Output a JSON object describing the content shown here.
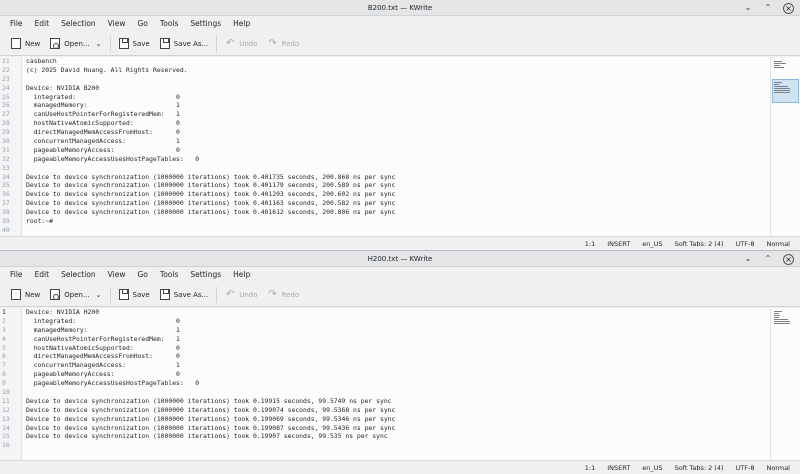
{
  "windows": [
    {
      "title": "B200.txt — KWrite",
      "menu": [
        "File",
        "Edit",
        "Selection",
        "View",
        "Go",
        "Tools",
        "Settings",
        "Help"
      ],
      "toolbar": {
        "new": "New",
        "open": "Open...",
        "save": "Save",
        "save_as": "Save As...",
        "undo": "Undo",
        "redo": "Redo"
      },
      "line_numbers": [
        "21",
        "22",
        "23",
        "24",
        "25",
        "26",
        "27",
        "28",
        "29",
        "30",
        "31",
        "32",
        "33",
        "34",
        "35",
        "36",
        "37",
        "38",
        "39",
        "40"
      ],
      "lines": [
        "casbench",
        "(c) 2025 David Huang. All Rights Reserved.",
        "",
        "Device: NVIDIA B200",
        "  integrated:                          0",
        "  managedMemory:                       1",
        "  canUseHostPointerForRegisteredMem:   1",
        "  hostNativeAtomicSupported:           0",
        "  directManagedMemAccessFromHost:      0",
        "  concurrentManagedAccess:             1",
        "  pageableMemoryAccess:                0",
        "  pageableMemoryAccessUsesHostPageTables:   0",
        "",
        "Device to device synchronization (1000000 iterations) took 0.401735 seconds, 200.868 ns per sync",
        "Device to device synchronization (1000000 iterations) took 0.401179 seconds, 200.589 ns per sync",
        "Device to device synchronization (1000000 iterations) took 0.401203 seconds, 200.602 ns per sync",
        "Device to device synchronization (1000000 iterations) took 0.401163 seconds, 200.582 ns per sync",
        "Device to device synchronization (1000000 iterations) took 0.401612 seconds, 200.806 ns per sync",
        "root:~#",
        ""
      ],
      "status": {
        "position": "1:1",
        "mode": "INSERT",
        "lang": "en_US",
        "tabs": "Soft Tabs: 2 (4)",
        "encoding": "UTF-8",
        "eol": "Normal"
      }
    },
    {
      "title": "H200.txt — KWrite",
      "menu": [
        "File",
        "Edit",
        "Selection",
        "View",
        "Go",
        "Tools",
        "Settings",
        "Help"
      ],
      "toolbar": {
        "new": "New",
        "open": "Open...",
        "save": "Save",
        "save_as": "Save As...",
        "undo": "Undo",
        "redo": "Redo"
      },
      "line_numbers": [
        "1",
        "2",
        "3",
        "4",
        "5",
        "6",
        "7",
        "8",
        "9",
        "10",
        "11",
        "12",
        "13",
        "14",
        "15",
        "16"
      ],
      "lines": [
        "Device: NVIDIA H200",
        "  integrated:                          0",
        "  managedMemory:                       1",
        "  canUseHostPointerForRegisteredMem:   1",
        "  hostNativeAtomicSupported:           0",
        "  directManagedMemAccessFromHost:      0",
        "  concurrentManagedAccess:             1",
        "  pageableMemoryAccess:                0",
        "  pageableMemoryAccessUsesHostPageTables:   0",
        "",
        "Device to device synchronization (1000000 iterations) took 0.19915 seconds, 99.5749 ns per sync",
        "Device to device synchronization (1000000 iterations) took 0.199074 seconds, 99.5368 ns per sync",
        "Device to device synchronization (1000000 iterations) took 0.199069 seconds, 99.5346 ns per sync",
        "Device to device synchronization (1000000 iterations) took 0.199087 seconds, 99.5436 ns per sync",
        "Device to device synchronization (1000000 iterations) took 0.19907 seconds, 99.535 ns per sync",
        ""
      ],
      "status": {
        "position": "1:1",
        "mode": "INSERT",
        "lang": "en_US",
        "tabs": "Soft Tabs: 2 (4)",
        "encoding": "UTF-8",
        "eol": "Normal"
      }
    }
  ],
  "titlebar_buttons": {
    "minimize": "⌄",
    "maximize": "⌃",
    "close": "×"
  }
}
